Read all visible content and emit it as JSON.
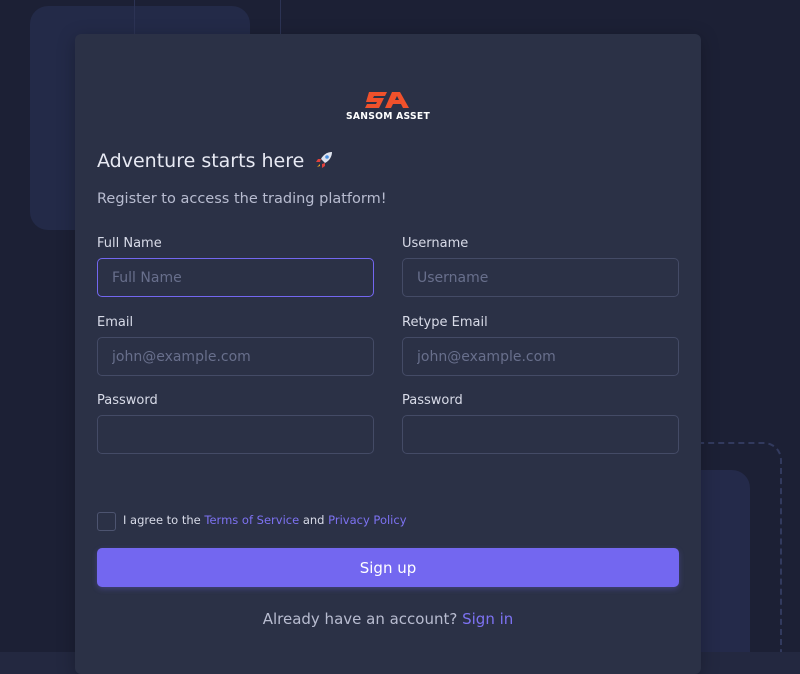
{
  "brand": {
    "name": "SANSOM ASSET",
    "accent_color": "#f0512b"
  },
  "header": {
    "title": "Adventure starts here",
    "title_icon": "rocket-icon",
    "subtitle": "Register to access the trading platform!"
  },
  "form": {
    "full_name": {
      "label": "Full Name",
      "placeholder": "Full Name",
      "value": ""
    },
    "username": {
      "label": "Username",
      "placeholder": "Username",
      "value": ""
    },
    "email": {
      "label": "Email",
      "placeholder": "john@example.com",
      "value": ""
    },
    "retype_email": {
      "label": "Retype Email",
      "placeholder": "john@example.com",
      "value": ""
    },
    "password": {
      "label": "Password",
      "placeholder": "",
      "value": ""
    },
    "retype_password": {
      "label": "Password",
      "placeholder": "",
      "value": ""
    }
  },
  "agreement": {
    "prefix": "I agree to the",
    "terms_link": "Terms of Service",
    "conjunction": "and",
    "privacy_link": "Privacy Policy",
    "checked": false
  },
  "submit": {
    "label": "Sign up"
  },
  "footer": {
    "text": "Already have an account?",
    "link": "Sign in"
  },
  "colors": {
    "primary": "#7367f0",
    "card_bg": "#2b3146",
    "page_bg": "#1c2035"
  }
}
